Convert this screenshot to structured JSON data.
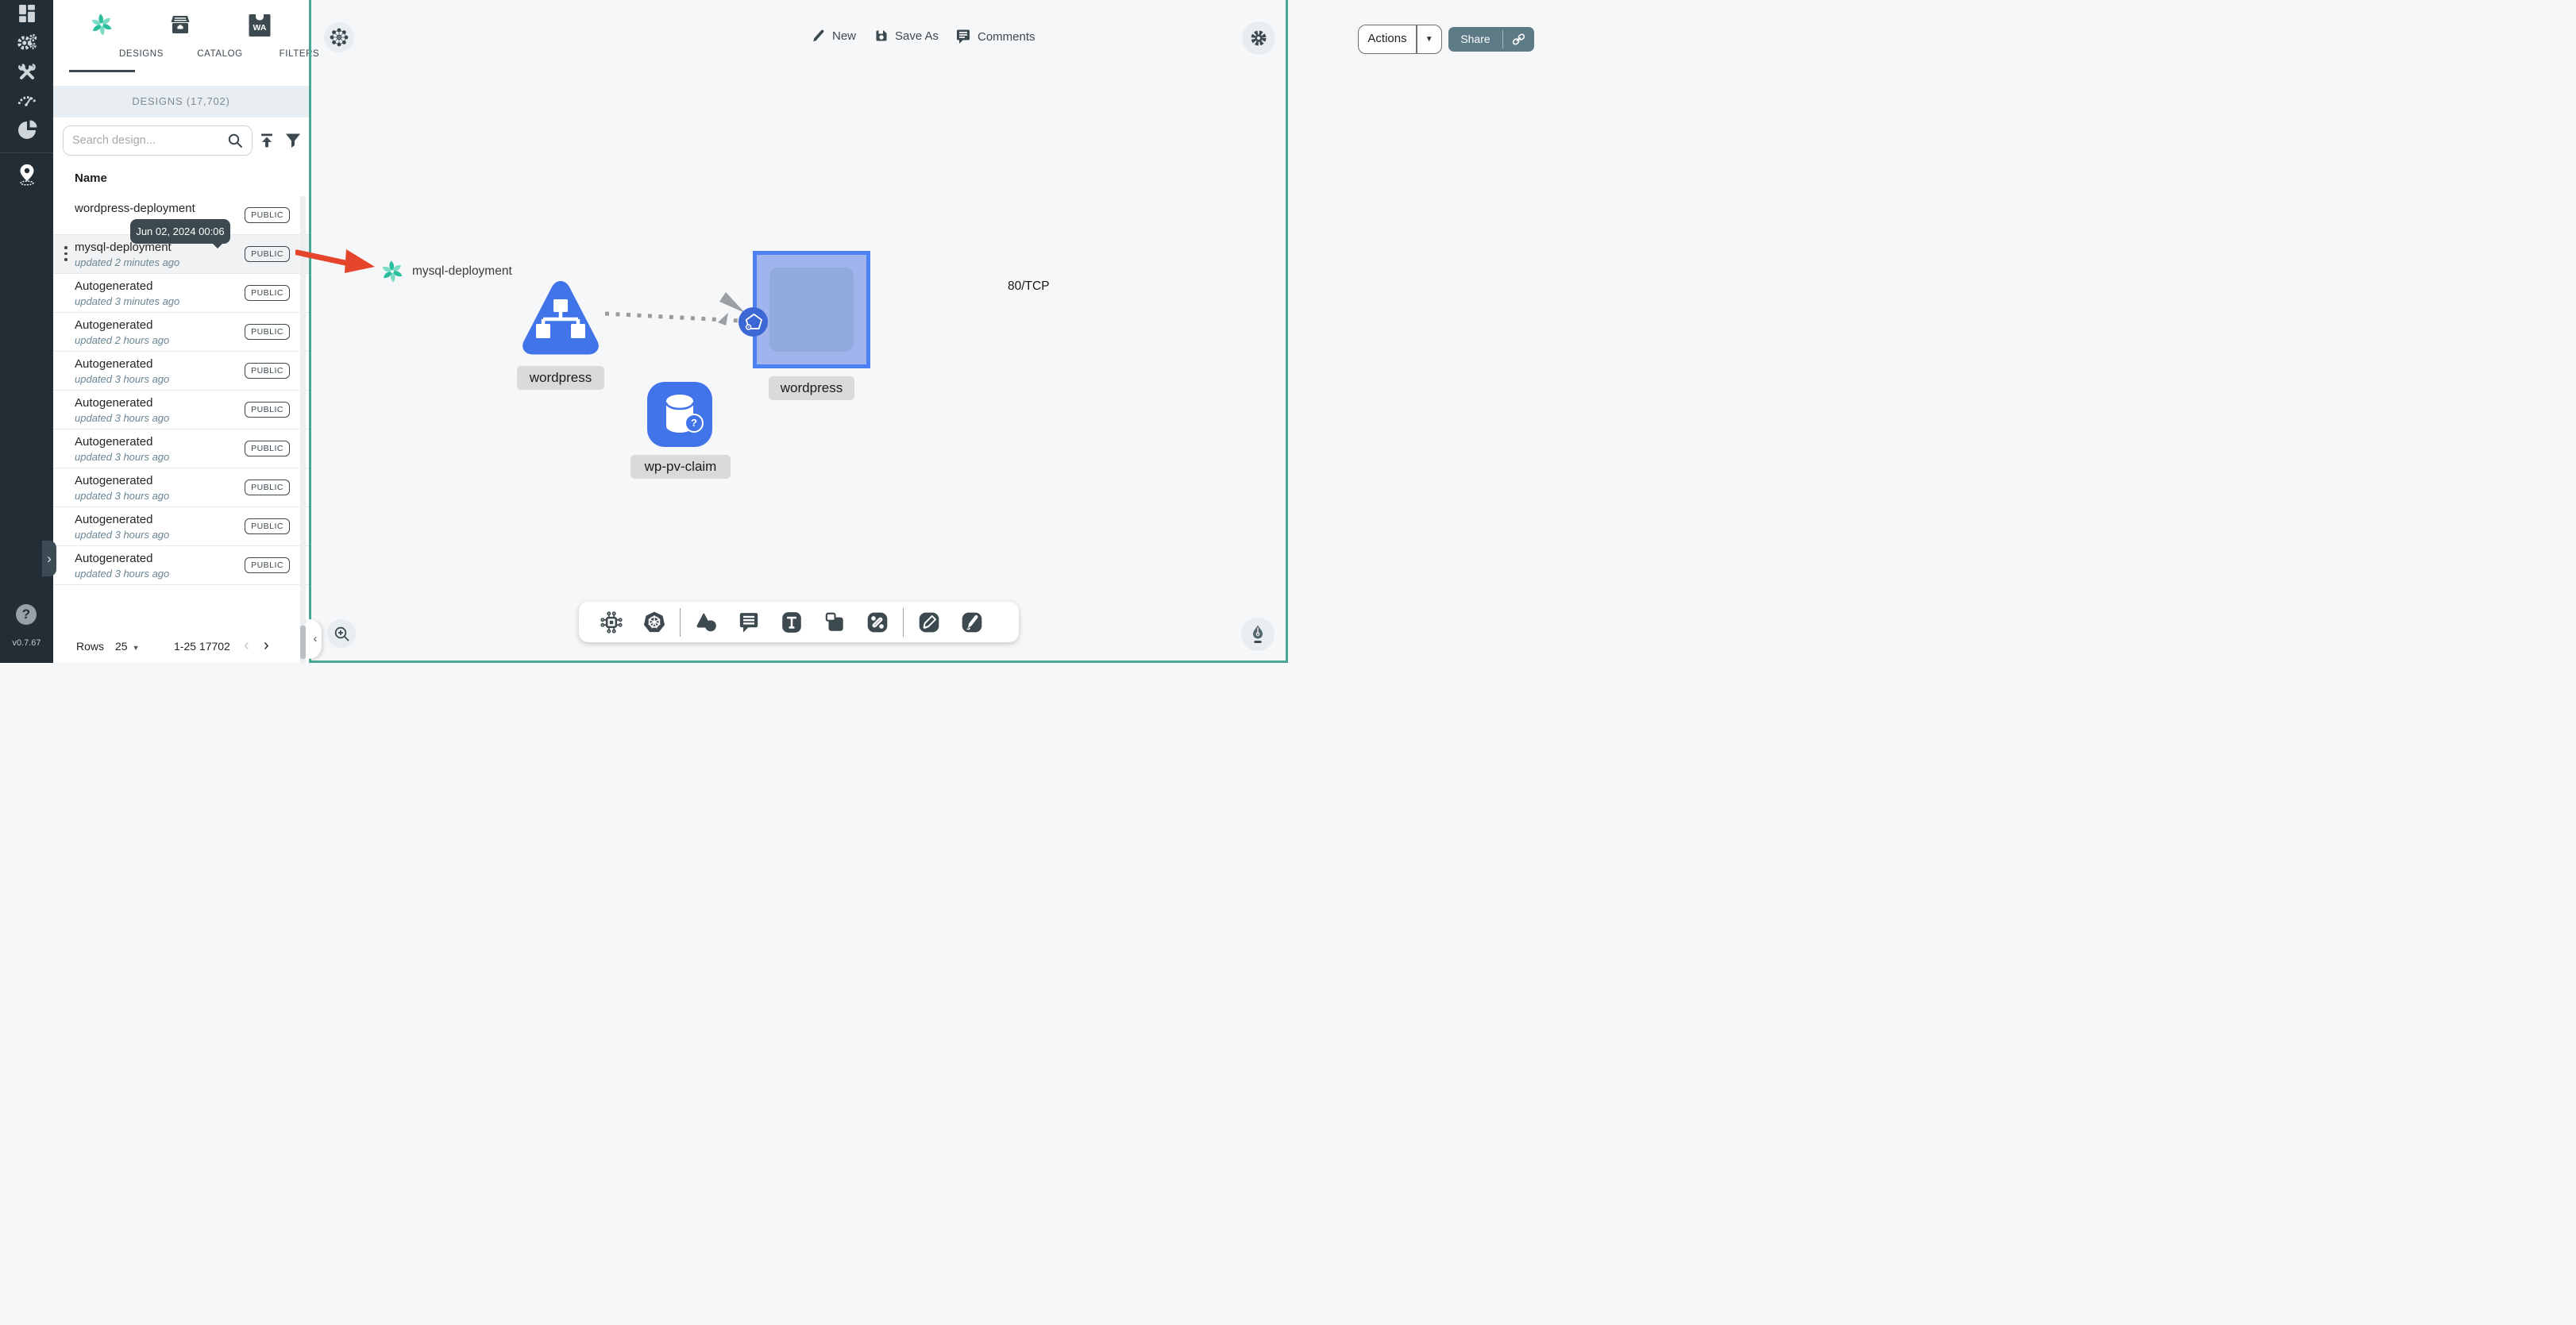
{
  "sidebar": {
    "icons": [
      "dashboard",
      "lifecycle",
      "configuration",
      "performance",
      "extensions",
      "kanvas"
    ],
    "expand_chevron": "›",
    "help": "?",
    "version": "v0.7.67"
  },
  "panel": {
    "tabs": [
      {
        "label": "DESIGNS",
        "active": true
      },
      {
        "label": "CATALOG",
        "active": false
      },
      {
        "label": "FILTERS",
        "active": false
      }
    ],
    "section_header": "DESIGNS (17,702)",
    "search_placeholder": "Search design...",
    "name_header": "Name",
    "rows": [
      {
        "name": "wordpress-deployment",
        "updated": "",
        "badge": "PUBLIC",
        "hovered": false
      },
      {
        "name": "mysql-deployment",
        "updated": "updated 2 minutes ago",
        "badge": "PUBLIC",
        "hovered": true
      },
      {
        "name": "Autogenerated",
        "updated": "updated 3 minutes ago",
        "badge": "PUBLIC",
        "hovered": false
      },
      {
        "name": "Autogenerated",
        "updated": "updated 2 hours ago",
        "badge": "PUBLIC",
        "hovered": false
      },
      {
        "name": "Autogenerated",
        "updated": "updated 3 hours ago",
        "badge": "PUBLIC",
        "hovered": false
      },
      {
        "name": "Autogenerated",
        "updated": "updated 3 hours ago",
        "badge": "PUBLIC",
        "hovered": false
      },
      {
        "name": "Autogenerated",
        "updated": "updated 3 hours ago",
        "badge": "PUBLIC",
        "hovered": false
      },
      {
        "name": "Autogenerated",
        "updated": "updated 3 hours ago",
        "badge": "PUBLIC",
        "hovered": false
      },
      {
        "name": "Autogenerated",
        "updated": "updated 3 hours ago",
        "badge": "PUBLIC",
        "hovered": false
      },
      {
        "name": "Autogenerated",
        "updated": "updated 3 hours ago",
        "badge": "PUBLIC",
        "hovered": false
      }
    ],
    "tooltip": "Jun 02, 2024 00:06",
    "pagination": {
      "rows_label": "Rows",
      "per_page": "25",
      "range": "1-25 17702",
      "prev": "‹",
      "next": "›"
    }
  },
  "topbar": {
    "new": "New",
    "save_as": "Save As",
    "comments": "Comments",
    "actions": "Actions",
    "share": "Share"
  },
  "canvas": {
    "drag_preview_label": "mysql-deployment",
    "edge_label": "80/TCP",
    "node_service_label": "wordpress",
    "node_deployment_label": "wordpress",
    "node_pvc_label": "wp-pv-claim",
    "bottom_toolbar_icons": [
      "component",
      "kubernetes",
      "shapes",
      "comment",
      "text",
      "section",
      "relationship",
      "pen",
      "brush"
    ],
    "corner_buttons": [
      "mesh",
      "zoom-in",
      "pen-nib",
      "settings"
    ],
    "collapse_chevron": "‹"
  },
  "colors": {
    "teal_frame": "#4AA795",
    "node_blue": "#4173E9",
    "deployment_border": "#4B81F2",
    "slate": "#3C494F",
    "red_arrow": "#E4452C"
  }
}
